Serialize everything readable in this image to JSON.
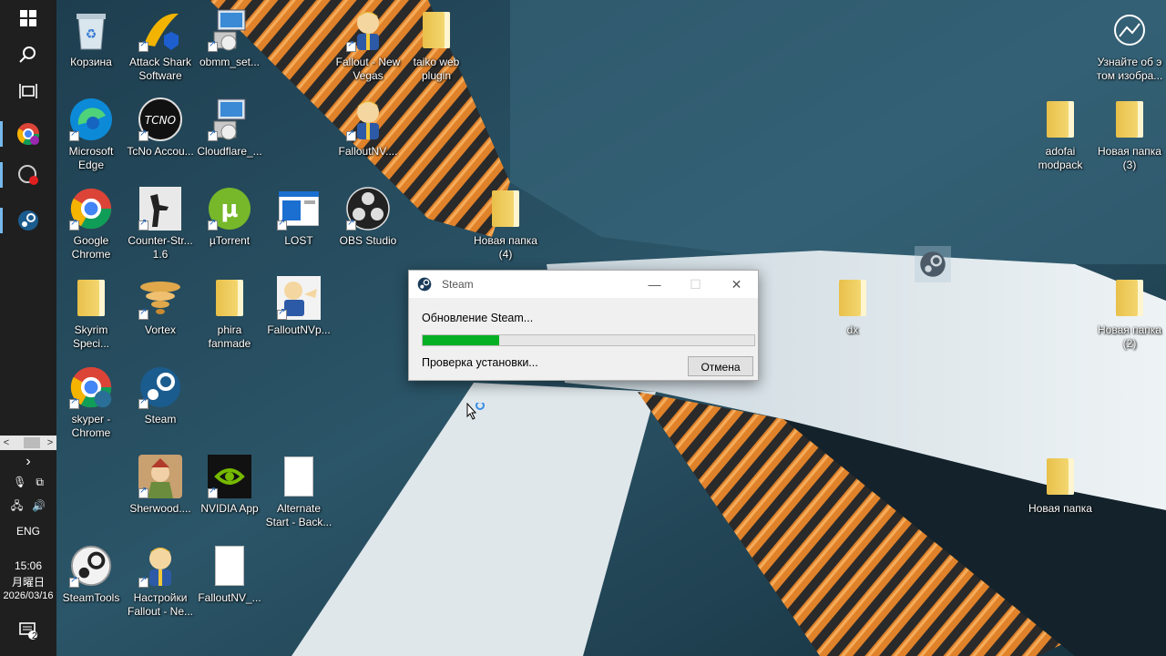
{
  "desktop": {
    "icons": [
      {
        "label": "Корзина",
        "icon": "recycle-bin-icon"
      },
      {
        "label": "Attack Shark Software",
        "icon": "attack-shark-icon"
      },
      {
        "label": "obmm_set...",
        "icon": "installer-icon"
      },
      {
        "label": "Fallout - New Vegas",
        "icon": "fallout-vault-boy-icon"
      },
      {
        "label": "taiko web plugin",
        "icon": "folder-icon"
      },
      {
        "label": "Microsoft Edge",
        "icon": "edge-icon"
      },
      {
        "label": "TcNo Accou...",
        "icon": "tcno-icon"
      },
      {
        "label": "Cloudflare_...",
        "icon": "installer-icon"
      },
      {
        "label": "FalloutNV....",
        "icon": "fallout-vault-boy-icon"
      },
      {
        "label": "Google Chrome",
        "icon": "chrome-icon"
      },
      {
        "label": "Counter-Str... 1.6",
        "icon": "counter-strike-icon"
      },
      {
        "label": "µTorrent",
        "icon": "utorrent-icon"
      },
      {
        "label": "LOST",
        "icon": "window-app-icon"
      },
      {
        "label": "OBS Studio",
        "icon": "obs-icon"
      },
      {
        "label": "Новая папка (4)",
        "icon": "folder-icon"
      },
      {
        "label": "Skyrim Speci...",
        "icon": "folder-icon"
      },
      {
        "label": "Vortex",
        "icon": "vortex-icon"
      },
      {
        "label": "phira fanmade",
        "icon": "folder-icon"
      },
      {
        "label": "FalloutNVp...",
        "icon": "fallout-vault-boy-icon"
      },
      {
        "label": "skyper - Chrome",
        "icon": "chrome-icon"
      },
      {
        "label": "Steam",
        "icon": "steam-icon"
      },
      {
        "label": "Sherwood....",
        "icon": "sherwood-icon"
      },
      {
        "label": "NVIDIA App",
        "icon": "nvidia-icon"
      },
      {
        "label": "Alternate Start - Back...",
        "icon": "document-icon"
      },
      {
        "label": "SteamTools",
        "icon": "steamtools-icon"
      },
      {
        "label": "Настройки Fallout - Ne...",
        "icon": "fallout-vault-boy-icon"
      },
      {
        "label": "FalloutNV_...",
        "icon": "document-icon"
      },
      {
        "label": "Узнайте об э том изобра...",
        "icon": "learn-about-picture-icon"
      },
      {
        "label": "adofai modpack",
        "icon": "folder-icon"
      },
      {
        "label": "Новая папка (3)",
        "icon": "folder-icon"
      },
      {
        "label": "dx",
        "icon": "folder-icon"
      },
      {
        "label": "Новая папка (2)",
        "icon": "folder-icon"
      },
      {
        "label": "Новая папка",
        "icon": "folder-icon"
      }
    ]
  },
  "taskbar": {
    "language": "ENG",
    "time": "15:06",
    "weekday": "月曜日",
    "date": "2026/03/16",
    "notification_count": "2"
  },
  "dialog": {
    "title": "Steam",
    "message": "Обновление Steam...",
    "progress": 0.23,
    "status": "Проверка установки...",
    "cancel_label": "Отмена"
  },
  "colors": {
    "taskbar_bg": "#1f1f1f",
    "progress_fill": "#06b025",
    "accent": "#76b9ed"
  }
}
